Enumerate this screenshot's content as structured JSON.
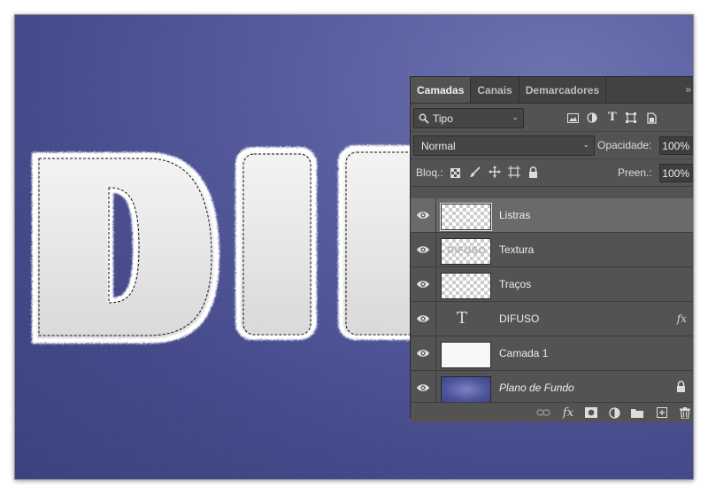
{
  "canvas": {
    "text": "DIFUSO",
    "background_color": "#4a5092",
    "fur_color": "#ececec"
  },
  "layers_panel": {
    "tabs": [
      {
        "label": "Camadas",
        "active": true
      },
      {
        "label": "Canais",
        "active": false
      },
      {
        "label": "Demarcadores",
        "active": false
      }
    ],
    "panel_menu": "»",
    "filter": {
      "icon": "search-icon",
      "value": "Tipo"
    },
    "filter_icons": [
      "image-filter-icon",
      "adjustment-filter-icon",
      "type-filter-icon",
      "shape-filter-icon",
      "smart-object-filter-icon"
    ],
    "blend_mode": "Normal",
    "opacity_label": "Opacidade:",
    "opacity_value": "100%",
    "lock_label": "Bloq.:",
    "lock_icons": [
      "lock-transparent-icon",
      "lock-paint-icon",
      "lock-position-icon",
      "lock-artboard-icon",
      "lock-all-icon"
    ],
    "fill_label": "Preen.:",
    "fill_value": "100%",
    "layers": [
      {
        "name": "Listras",
        "thumb": "transparent",
        "visible": true,
        "selected": true
      },
      {
        "name": "Textura",
        "thumb": "transparent",
        "thumb_text": "DIFUSO",
        "visible": true,
        "selected": false
      },
      {
        "name": "Traços",
        "thumb": "transparent",
        "visible": true,
        "selected": false
      },
      {
        "name": "DIFUSO",
        "thumb": "text",
        "thumb_glyph": "T",
        "visible": true,
        "selected": false,
        "badge": "fx"
      },
      {
        "name": "Camada 1",
        "thumb": "white",
        "visible": true,
        "selected": false
      },
      {
        "name": "Plano de Fundo",
        "thumb": "background",
        "visible": true,
        "selected": false,
        "locked": true,
        "italic": true
      }
    ],
    "footer_icons": [
      "link-layers-icon",
      "fx-icon",
      "add-mask-icon",
      "new-adjustment-icon",
      "new-group-icon",
      "new-layer-icon",
      "delete-layer-icon"
    ],
    "footer_fx_label": "fx"
  }
}
